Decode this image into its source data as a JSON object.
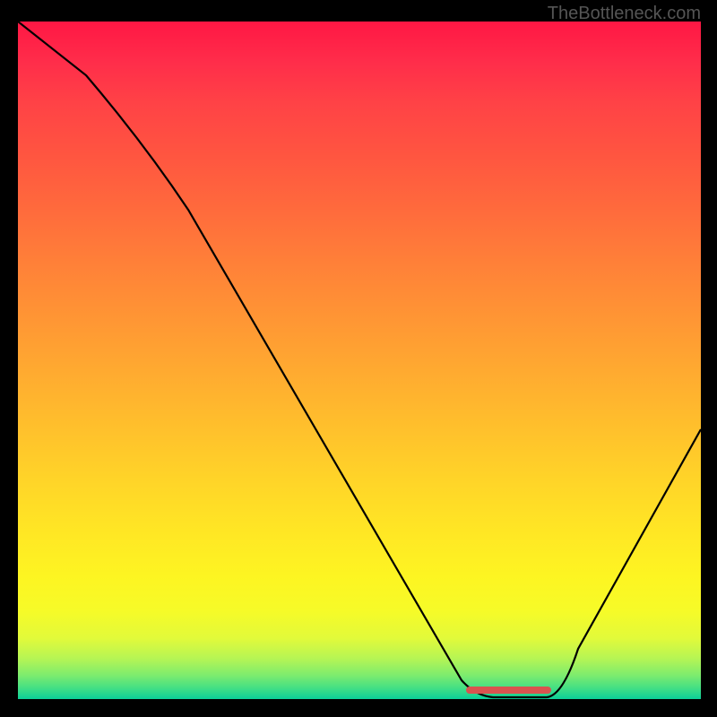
{
  "watermark": "TheBottleneck.com",
  "chart_data": {
    "type": "line",
    "title": "",
    "xlabel": "",
    "ylabel": "",
    "xlim": [
      0,
      100
    ],
    "ylim": [
      0,
      100
    ],
    "series": [
      {
        "name": "bottleneck-curve",
        "x": [
          0,
          10,
          20,
          25,
          30,
          40,
          50,
          60,
          65,
          68,
          70,
          72,
          75,
          78,
          82,
          90,
          100
        ],
        "values": [
          100,
          92,
          80,
          72,
          65,
          50,
          35,
          20,
          10,
          4,
          1,
          0,
          0,
          1,
          7,
          20,
          40
        ]
      }
    ],
    "minimum_marker": {
      "x_start": 68,
      "x_end": 78,
      "y": 1.3,
      "color": "#d9534f"
    },
    "gradient_stops": [
      {
        "pos": 0,
        "color": "#ff1744"
      },
      {
        "pos": 50,
        "color": "#ff9634"
      },
      {
        "pos": 80,
        "color": "#fdf522"
      },
      {
        "pos": 100,
        "color": "#0bcf98"
      }
    ]
  }
}
